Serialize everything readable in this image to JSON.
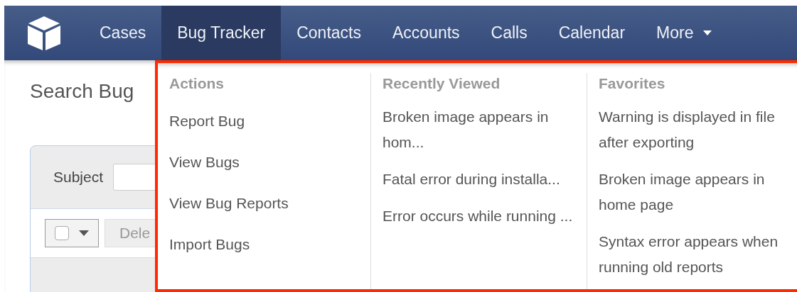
{
  "nav": {
    "items": [
      {
        "label": "Cases",
        "selected": false
      },
      {
        "label": "Bug Tracker",
        "selected": true
      },
      {
        "label": "Contacts",
        "selected": false
      },
      {
        "label": "Accounts",
        "selected": false
      },
      {
        "label": "Calls",
        "selected": false
      },
      {
        "label": "Calendar",
        "selected": false
      }
    ],
    "more": "More"
  },
  "page": {
    "title": "Search Bug",
    "filter_label": "Subject",
    "select_all_checked": false,
    "delete_button": "Dele"
  },
  "menu": {
    "columns": [
      {
        "heading": "Actions",
        "items": [
          "Report Bug",
          "View Bugs",
          "View Bug Reports",
          "Import Bugs"
        ]
      },
      {
        "heading": "Recently Viewed",
        "items": [
          "Broken image appears in hom...",
          "Fatal error during installa...",
          "Error occurs while running ..."
        ]
      },
      {
        "heading": "Favorites",
        "items": [
          "Warning is displayed in file after exporting",
          "Broken image appears in home page",
          "Syntax error appears when running old reports"
        ]
      }
    ]
  }
}
